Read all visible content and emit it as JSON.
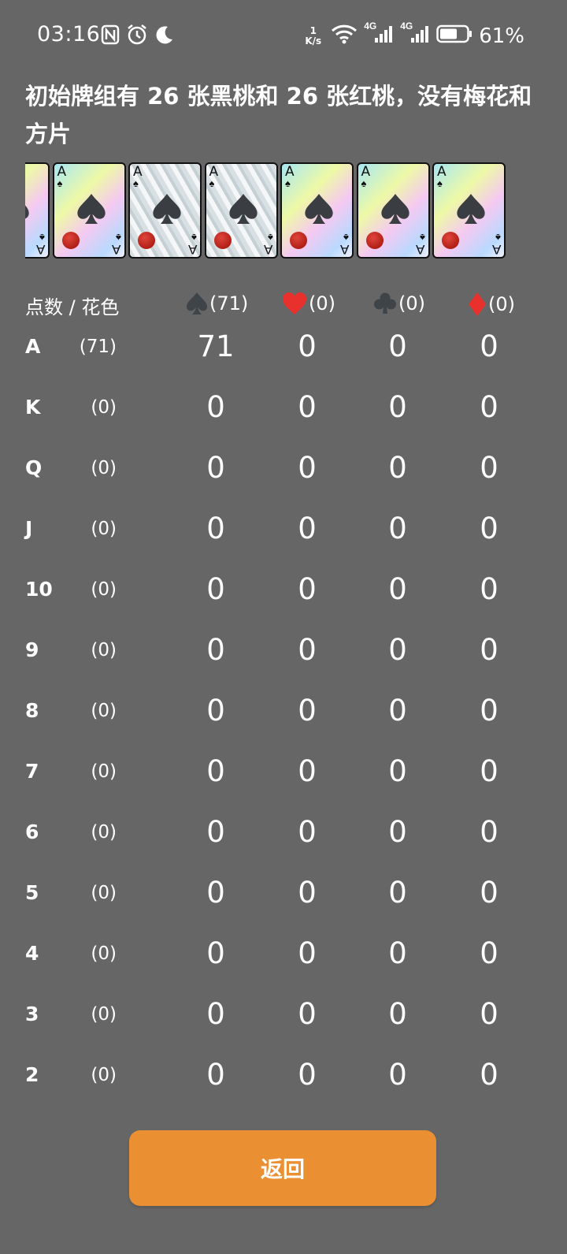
{
  "status_bar": {
    "time": "03:16",
    "net_speed_value": "1",
    "net_speed_unit": "K/s",
    "signal1_label": "4G",
    "signal2_label": "4G",
    "battery": "61%",
    "icons": [
      "nfc-icon",
      "alarm-icon",
      "moon-icon",
      "wifi-icon",
      "signal-icon",
      "battery-icon"
    ]
  },
  "title": "初始牌组有 26 张黑桃和 26 张红桃，没有梅花和方片",
  "cards": [
    {
      "rank": "A",
      "suit": "spade",
      "style": "rainbow"
    },
    {
      "rank": "A",
      "suit": "spade",
      "style": "rainbow"
    },
    {
      "rank": "A",
      "suit": "spade",
      "style": "silver"
    },
    {
      "rank": "A",
      "suit": "spade",
      "style": "silver"
    },
    {
      "rank": "A",
      "suit": "spade",
      "style": "rainbow"
    },
    {
      "rank": "A",
      "suit": "spade",
      "style": "rainbow"
    },
    {
      "rank": "A",
      "suit": "spade",
      "style": "rainbow"
    }
  ],
  "table": {
    "header_label": "点数 / 花色",
    "suits": [
      {
        "name": "spade",
        "count": "(71)",
        "color": "#3f4448"
      },
      {
        "name": "heart",
        "count": "(0)",
        "color": "#e8312c"
      },
      {
        "name": "club",
        "count": "(0)",
        "color": "#3f4448"
      },
      {
        "name": "diamond",
        "count": "(0)",
        "color": "#e8312c"
      }
    ],
    "rows": [
      {
        "rank": "A",
        "count": "(71)",
        "values": [
          "71",
          "0",
          "0",
          "0"
        ]
      },
      {
        "rank": "K",
        "count": "(0)",
        "values": [
          "0",
          "0",
          "0",
          "0"
        ]
      },
      {
        "rank": "Q",
        "count": "(0)",
        "values": [
          "0",
          "0",
          "0",
          "0"
        ]
      },
      {
        "rank": "J",
        "count": "(0)",
        "values": [
          "0",
          "0",
          "0",
          "0"
        ]
      },
      {
        "rank": "10",
        "count": "(0)",
        "values": [
          "0",
          "0",
          "0",
          "0"
        ]
      },
      {
        "rank": "9",
        "count": "(0)",
        "values": [
          "0",
          "0",
          "0",
          "0"
        ]
      },
      {
        "rank": "8",
        "count": "(0)",
        "values": [
          "0",
          "0",
          "0",
          "0"
        ]
      },
      {
        "rank": "7",
        "count": "(0)",
        "values": [
          "0",
          "0",
          "0",
          "0"
        ]
      },
      {
        "rank": "6",
        "count": "(0)",
        "values": [
          "0",
          "0",
          "0",
          "0"
        ]
      },
      {
        "rank": "5",
        "count": "(0)",
        "values": [
          "0",
          "0",
          "0",
          "0"
        ]
      },
      {
        "rank": "4",
        "count": "(0)",
        "values": [
          "0",
          "0",
          "0",
          "0"
        ]
      },
      {
        "rank": "3",
        "count": "(0)",
        "values": [
          "0",
          "0",
          "0",
          "0"
        ]
      },
      {
        "rank": "2",
        "count": "(0)",
        "values": [
          "0",
          "0",
          "0",
          "0"
        ]
      }
    ]
  },
  "back_button": {
    "label": "返回",
    "color": "#ea9033"
  }
}
